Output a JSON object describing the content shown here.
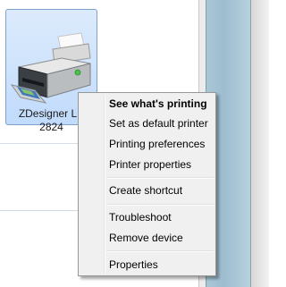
{
  "device": {
    "label": "ZDesigner LP\n2824",
    "icon": "printer-icon"
  },
  "context_menu": {
    "groups": [
      [
        "See what's printing",
        "Set as default printer",
        "Printing preferences",
        "Printer properties"
      ],
      [
        "Create shortcut"
      ],
      [
        "Troubleshoot",
        "Remove device"
      ],
      [
        "Properties"
      ]
    ],
    "default_item": "See what's printing"
  },
  "colors": {
    "selection_fill": "#c1dbfc",
    "selection_border": "#7da2ce",
    "menu_background": "#f0f0f0",
    "window_glass": "#a9c6d6"
  }
}
